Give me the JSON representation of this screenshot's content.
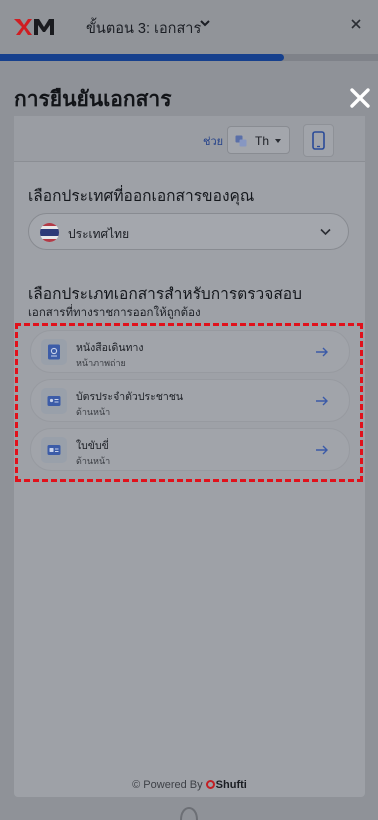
{
  "header": {
    "step_title": "ขั้นตอน 3: เอกสาร",
    "progress": 0.75,
    "accent_color": "#16408d"
  },
  "page": {
    "heading": "การยืนยันเอกสาร"
  },
  "modal": {
    "help_label": "ช่วย",
    "language_label": "Th",
    "country_section_label": "เลือกประเทศที่ออกเอกสารของคุณ",
    "country_value": "ประเทศไทย",
    "doc_section_label": "เลือกประเภทเอกสารสำหรับการตรวจสอบ",
    "doc_section_subtitle": "เอกสารที่ทางราชการออกให้ถูกต้อง",
    "documents": [
      {
        "name": "หนังสือเดินทาง",
        "hint": "หน้าภาพถ่าย",
        "icon": "passport-icon"
      },
      {
        "name": "บัตรประจำตัวประชาชน",
        "hint": "ด้านหน้า",
        "icon": "id-card-icon"
      },
      {
        "name": "ใบขับขี่",
        "hint": "ด้านหน้า",
        "icon": "driving-license-icon"
      }
    ],
    "powered_by": "© Powered By",
    "brand": "Shufti",
    "highlight_color": "#e1111b"
  }
}
